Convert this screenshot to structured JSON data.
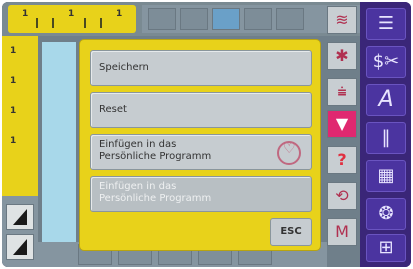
{
  "ruler": {
    "top_numbers": [
      "1",
      "1",
      "1"
    ],
    "left_numbers": [
      "1",
      "1",
      "1",
      "1"
    ]
  },
  "dialog": {
    "items": [
      {
        "label_line1": "Speichern",
        "label_line2": ""
      },
      {
        "label_line1": "Reset",
        "label_line2": ""
      },
      {
        "label_line1": "Einfügen in das",
        "label_line2": "Persönliche Programm"
      },
      {
        "label_line1": "Einfügen in das",
        "label_line2": "Persönliche Programm"
      }
    ],
    "esc_label": "ESC"
  },
  "sidebar": {
    "buttons": [
      {
        "icon": "stitch-list-icon",
        "glyph": "☰"
      },
      {
        "icon": "scissors-icon",
        "glyph": "$✂"
      },
      {
        "icon": "alphabet-icon",
        "glyph": "A"
      },
      {
        "icon": "buttonhole-icon",
        "glyph": "‖"
      },
      {
        "icon": "quilt-icon",
        "glyph": "▦"
      },
      {
        "icon": "decorative-icon",
        "glyph": "❂"
      },
      {
        "icon": "personal-program-icon",
        "glyph": "⊞"
      }
    ]
  },
  "right_col": {
    "buttons": [
      {
        "icon": "stitch-width-icon",
        "glyph": "≋"
      },
      {
        "icon": "needle-position-icon",
        "glyph": "✱"
      },
      {
        "icon": "mirror-icon",
        "glyph": "⩧"
      },
      {
        "icon": "arrow-down-icon",
        "glyph": "▼"
      },
      {
        "icon": "help-icon",
        "glyph": "?"
      },
      {
        "icon": "rotate-icon",
        "glyph": "⟲"
      },
      {
        "icon": "memory-icon",
        "glyph": "M"
      }
    ]
  },
  "colors": {
    "dialog_bg": "#e8d21a",
    "sidebar_bg": "#3a2678",
    "accent_pink": "#e02870"
  }
}
